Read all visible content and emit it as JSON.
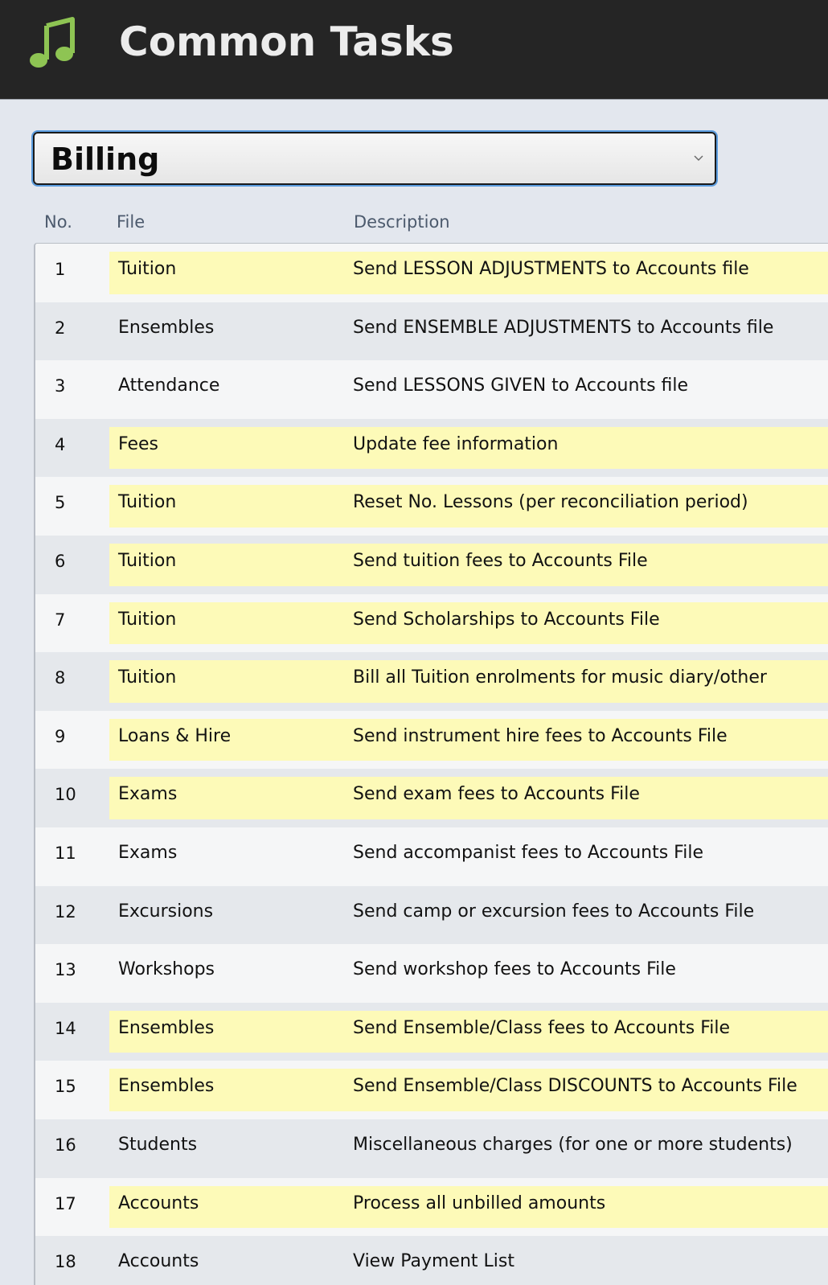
{
  "header": {
    "title": "Common Tasks",
    "icon": "music-note-icon",
    "icon_color": "#8ec453"
  },
  "category_select": {
    "selected": "Billing"
  },
  "table": {
    "columns": [
      "No.",
      "File",
      "Description"
    ],
    "highlight_color": "#fdfab8",
    "rows": [
      {
        "no": "1",
        "file": "Tuition",
        "description": "Send LESSON ADJUSTMENTS to Accounts file",
        "highlighted": true
      },
      {
        "no": "2",
        "file": "Ensembles",
        "description": "Send ENSEMBLE ADJUSTMENTS to Accounts file",
        "highlighted": false
      },
      {
        "no": "3",
        "file": "Attendance",
        "description": "Send LESSONS GIVEN to Accounts file",
        "highlighted": false
      },
      {
        "no": "4",
        "file": "Fees",
        "description": "Update fee information",
        "highlighted": true
      },
      {
        "no": "5",
        "file": "Tuition",
        "description": "Reset No. Lessons (per reconciliation period)",
        "highlighted": true
      },
      {
        "no": "6",
        "file": "Tuition",
        "description": "Send tuition fees to Accounts File",
        "highlighted": true
      },
      {
        "no": "7",
        "file": "Tuition",
        "description": "Send Scholarships to Accounts File",
        "highlighted": true
      },
      {
        "no": "8",
        "file": "Tuition",
        "description": "Bill all Tuition enrolments for music diary/other",
        "highlighted": true
      },
      {
        "no": "9",
        "file": "Loans & Hire",
        "description": "Send instrument hire fees to Accounts File",
        "highlighted": true
      },
      {
        "no": "10",
        "file": "Exams",
        "description": "Send exam fees to Accounts File",
        "highlighted": true
      },
      {
        "no": "11",
        "file": "Exams",
        "description": "Send accompanist fees to Accounts File",
        "highlighted": false
      },
      {
        "no": "12",
        "file": "Excursions",
        "description": "Send camp or excursion fees to Accounts File",
        "highlighted": false
      },
      {
        "no": "13",
        "file": "Workshops",
        "description": "Send workshop fees to Accounts File",
        "highlighted": false
      },
      {
        "no": "14",
        "file": "Ensembles",
        "description": "Send Ensemble/Class fees to Accounts File",
        "highlighted": true
      },
      {
        "no": "15",
        "file": "Ensembles",
        "description": "Send Ensemble/Class DISCOUNTS to Accounts File",
        "highlighted": true
      },
      {
        "no": "16",
        "file": "Students",
        "description": "Miscellaneous charges (for one or more students)",
        "highlighted": false
      },
      {
        "no": "17",
        "file": "Accounts",
        "description": "Process all unbilled amounts",
        "highlighted": true
      },
      {
        "no": "18",
        "file": "Accounts",
        "description": "View Payment List",
        "highlighted": false
      }
    ]
  }
}
